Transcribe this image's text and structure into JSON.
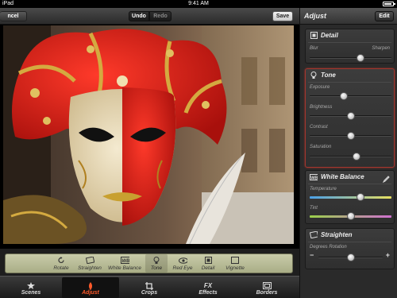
{
  "status_bar": {
    "left_text": "iPad",
    "time": "9:41 AM",
    "battery_level": 0.85
  },
  "toolbar": {
    "cancel_label": "ncel",
    "undo_label": "Undo",
    "redo_label": "Redo",
    "save_label": "Save"
  },
  "photo": {
    "subject": "venetian-carnival-mask-photo"
  },
  "tools": [
    {
      "label": "Rotate",
      "icon": "rotate-icon"
    },
    {
      "label": "Straighten",
      "icon": "straighten-icon"
    },
    {
      "label": "White Balance",
      "icon": "white-balance-icon"
    },
    {
      "label": "Tone",
      "icon": "bulb-icon"
    },
    {
      "label": "Red Eye",
      "icon": "eye-icon"
    },
    {
      "label": "Detail",
      "icon": "detail-icon"
    },
    {
      "label": "Vignette",
      "icon": "vignette-icon"
    }
  ],
  "active_tool": "Tone",
  "tabs": [
    {
      "label": "Scenes",
      "icon": "scenes-icon"
    },
    {
      "label": "Adjust",
      "icon": "adjust-icon"
    },
    {
      "label": "Crops",
      "icon": "crop-icon"
    },
    {
      "label": "FX\nEffects",
      "label_top": "FX",
      "label_bottom": "Effects",
      "icon": "fx-icon"
    },
    {
      "label": "Borders",
      "icon": "borders-icon"
    }
  ],
  "active_tab": "Adjust",
  "sidebar": {
    "title": "Adjust",
    "edit_label": "Edit",
    "detail": {
      "title": "Detail",
      "left_label": "Blur",
      "right_label": "Sharpen",
      "value": 0.62
    },
    "tone": {
      "title": "Tone",
      "sliders": [
        {
          "label": "Exposure",
          "value": 0.42
        },
        {
          "label": "Brightness",
          "value": 0.5
        },
        {
          "label": "Contrast",
          "value": 0.5
        },
        {
          "label": "Saturation",
          "value": 0.57
        }
      ]
    },
    "white_balance": {
      "title": "White Balance",
      "sliders": [
        {
          "label": "Temperature",
          "value": 0.62
        },
        {
          "label": "Tint",
          "value": 0.5
        }
      ]
    },
    "straighten": {
      "title": "Straighten",
      "label": "Degrees Rotation",
      "minus": "−",
      "plus": "+",
      "value": 0.5
    }
  },
  "colors": {
    "accent": "#ff5a2a",
    "active_border": "#a3362e"
  }
}
